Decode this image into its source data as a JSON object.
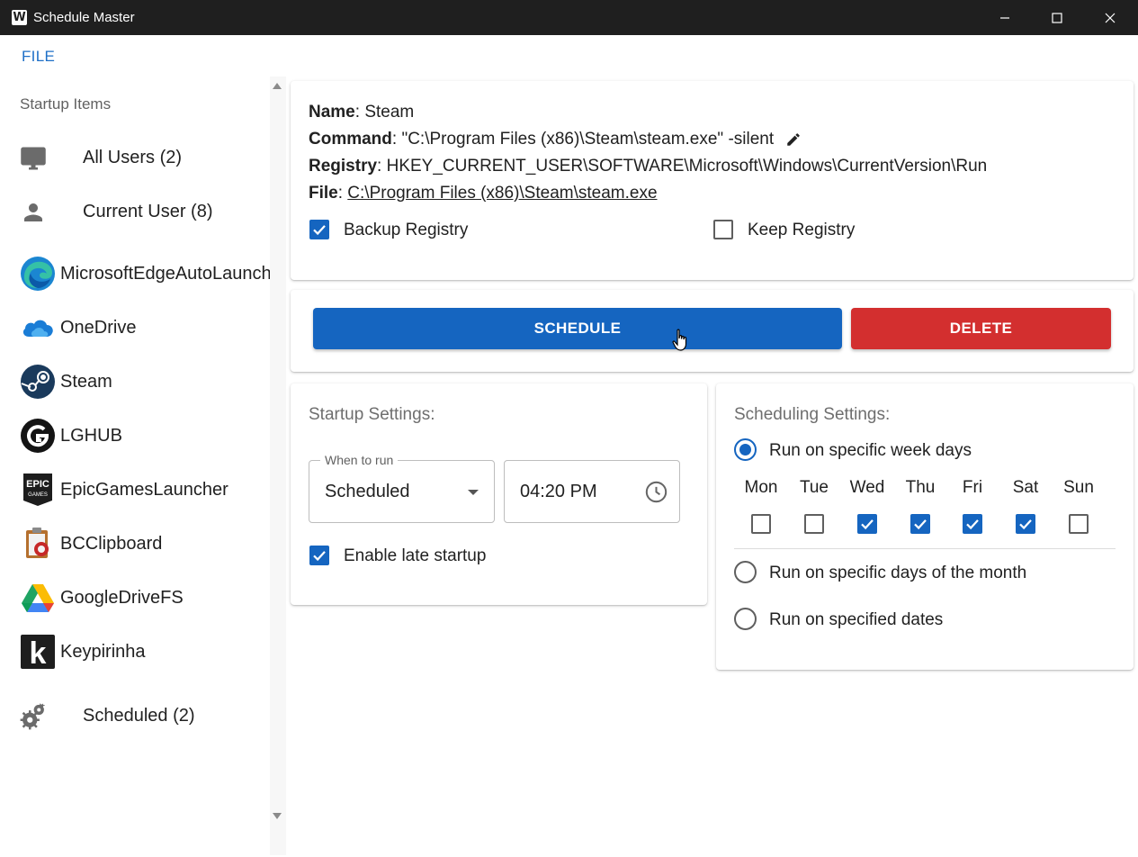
{
  "window": {
    "title": "Schedule Master",
    "logo_letter": "W",
    "controls": [
      "minimize-icon",
      "maximize-icon",
      "close-icon"
    ]
  },
  "menu": {
    "file_label": "FILE"
  },
  "sidebar": {
    "header": "Startup Items",
    "categories": [
      {
        "label": "All Users (2)",
        "icon": "monitor-icon"
      },
      {
        "label": "Current User (8)",
        "icon": "person-icon"
      }
    ],
    "apps": [
      {
        "label": "MicrosoftEdgeAutoLaunch",
        "icon": "edge-icon"
      },
      {
        "label": "OneDrive",
        "icon": "onedrive-icon"
      },
      {
        "label": "Steam",
        "icon": "steam-icon"
      },
      {
        "label": "LGHUB",
        "icon": "lghub-icon"
      },
      {
        "label": "EpicGamesLauncher",
        "icon": "epic-games-icon",
        "logo_text": [
          "EPIC",
          "GAMES"
        ]
      },
      {
        "label": "BCClipboard",
        "icon": "bcclipboard-icon"
      },
      {
        "label": "GoogleDriveFS",
        "icon": "google-drive-icon"
      },
      {
        "label": "Keypirinha",
        "icon": "keypirinha-icon",
        "logo_text": "k"
      }
    ],
    "scheduled": {
      "label": "Scheduled (2)",
      "icon": "gear-icon"
    }
  },
  "details": {
    "name_key": "Name",
    "name_value": "Steam",
    "command_key": "Command",
    "command_value": "\"C:\\Program Files (x86)\\Steam\\steam.exe\" -silent",
    "registry_key": "Registry",
    "registry_value": "HKEY_CURRENT_USER\\SOFTWARE\\Microsoft\\Windows\\CurrentVersion\\Run",
    "file_key": "File",
    "file_value": "C:\\Program Files (x86)\\Steam\\steam.exe",
    "separator": ": ",
    "backup_registry": {
      "label": "Backup Registry",
      "checked": true
    },
    "keep_registry": {
      "label": "Keep Registry",
      "checked": false
    }
  },
  "actions": {
    "schedule_label": "SCHEDULE",
    "delete_label": "DELETE",
    "colors": {
      "schedule": "#1565c0",
      "delete": "#d32f2f"
    }
  },
  "startup_settings": {
    "title": "Startup Settings:",
    "when_to_run_label": "When to run",
    "when_to_run_value": "Scheduled",
    "time_value": "04:20 PM",
    "late_startup": {
      "label": "Enable late startup",
      "checked": true
    }
  },
  "scheduling_settings": {
    "title": "Scheduling Settings:",
    "options": [
      {
        "label": "Run on specific week days",
        "selected": true
      },
      {
        "label": "Run on specific days of the month",
        "selected": false
      },
      {
        "label": "Run on specified dates",
        "selected": false
      }
    ],
    "days": [
      {
        "label": "Mon",
        "checked": false
      },
      {
        "label": "Tue",
        "checked": false
      },
      {
        "label": "Wed",
        "checked": true
      },
      {
        "label": "Thu",
        "checked": true
      },
      {
        "label": "Fri",
        "checked": true
      },
      {
        "label": "Sat",
        "checked": true
      },
      {
        "label": "Sun",
        "checked": false
      }
    ]
  },
  "accent_color": "#1565c0"
}
